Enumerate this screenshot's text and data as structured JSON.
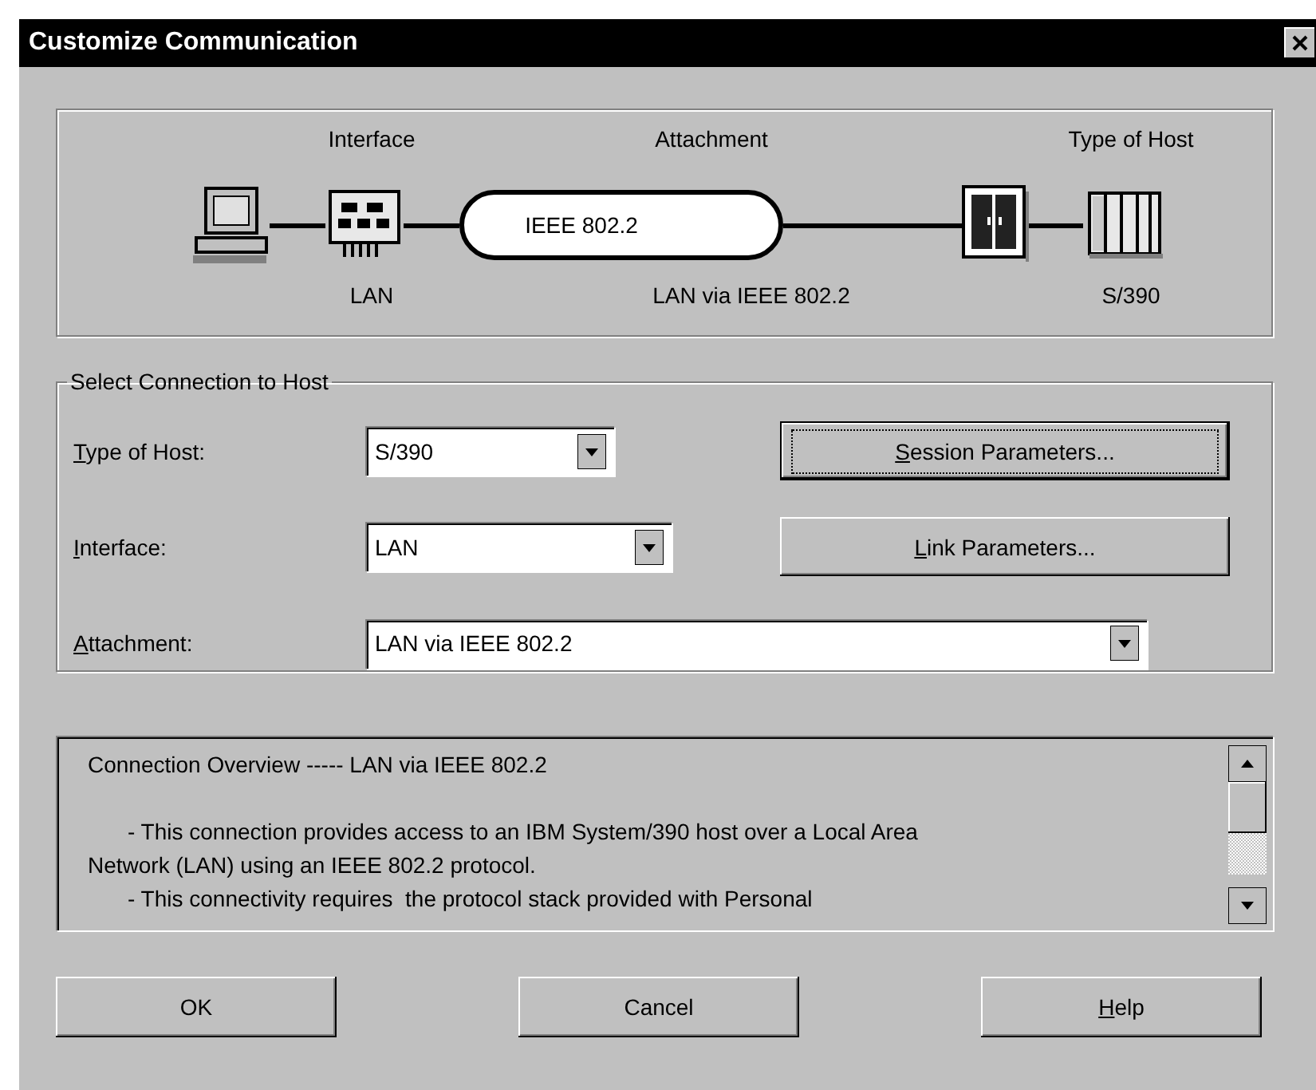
{
  "window": {
    "title": "Customize Communication"
  },
  "diagram": {
    "headings": [
      "Interface",
      "Attachment",
      "Type of Host"
    ],
    "oval": "IEEE 802.2",
    "captions": [
      "LAN",
      "LAN via IEEE 802.2",
      "S/390"
    ]
  },
  "connection": {
    "legend": "Select Connection to Host",
    "fields": [
      {
        "accel": "T",
        "label": "ype of Host:",
        "value": "S/390"
      },
      {
        "accel": "I",
        "label": "nterface:",
        "value": "LAN"
      },
      {
        "accel": "A",
        "label": "ttachment:",
        "value": "LAN via IEEE 802.2"
      }
    ],
    "buttons": [
      {
        "accel": "S",
        "label": "ession Parameters...",
        "focused": true
      },
      {
        "accel": "L",
        "label": "ink Parameters...",
        "focused": false
      }
    ]
  },
  "overview": {
    "lines": [
      {
        "kind": "heading",
        "text": "Connection Overview ----- LAN via IEEE 802.2"
      },
      {
        "kind": "indent",
        "text": "- This connection provides access to an IBM System/390 host over a Local Area"
      },
      {
        "kind": "plain",
        "text": "Network (LAN) using an IEEE 802.2 protocol."
      },
      {
        "kind": "indent",
        "text": "- This connectivity requires  the protocol stack provided with Personal"
      }
    ]
  },
  "buttons": [
    {
      "label": "OK"
    },
    {
      "label": "Cancel"
    },
    {
      "accel": "H",
      "label": "elp"
    }
  ]
}
